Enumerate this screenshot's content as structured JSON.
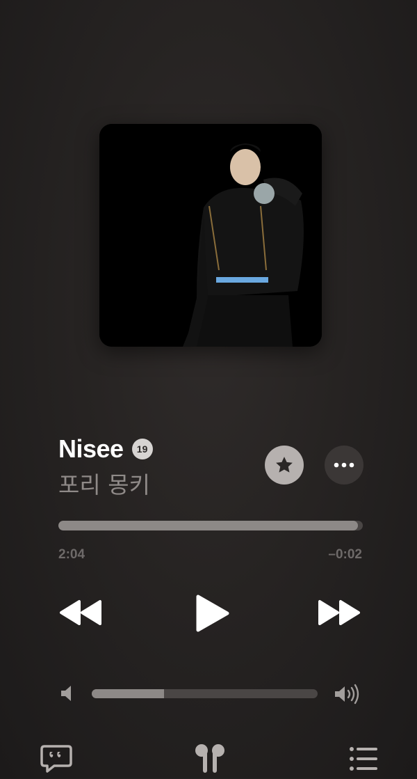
{
  "track": {
    "title": "Nisee",
    "explicit_badge": "19",
    "artist": "포리 몽키",
    "progress_fraction": 0.985
  },
  "time": {
    "elapsed": "2:04",
    "remaining": "–0:02"
  },
  "volume": {
    "level_fraction": 0.32
  },
  "icons": {
    "favorite": "star-icon",
    "more": "ellipsis-icon",
    "rewind": "rewind-icon",
    "play": "play-icon",
    "forward": "fast-forward-icon",
    "volume_low": "speaker-low-icon",
    "volume_high": "speaker-high-icon",
    "lyrics": "lyrics-quote-icon",
    "airpods": "airpods-icon",
    "queue": "queue-list-icon"
  },
  "colors": {
    "background": "#262322",
    "accent_grey": "#b6b1af",
    "track_fill": "#8d8987"
  }
}
